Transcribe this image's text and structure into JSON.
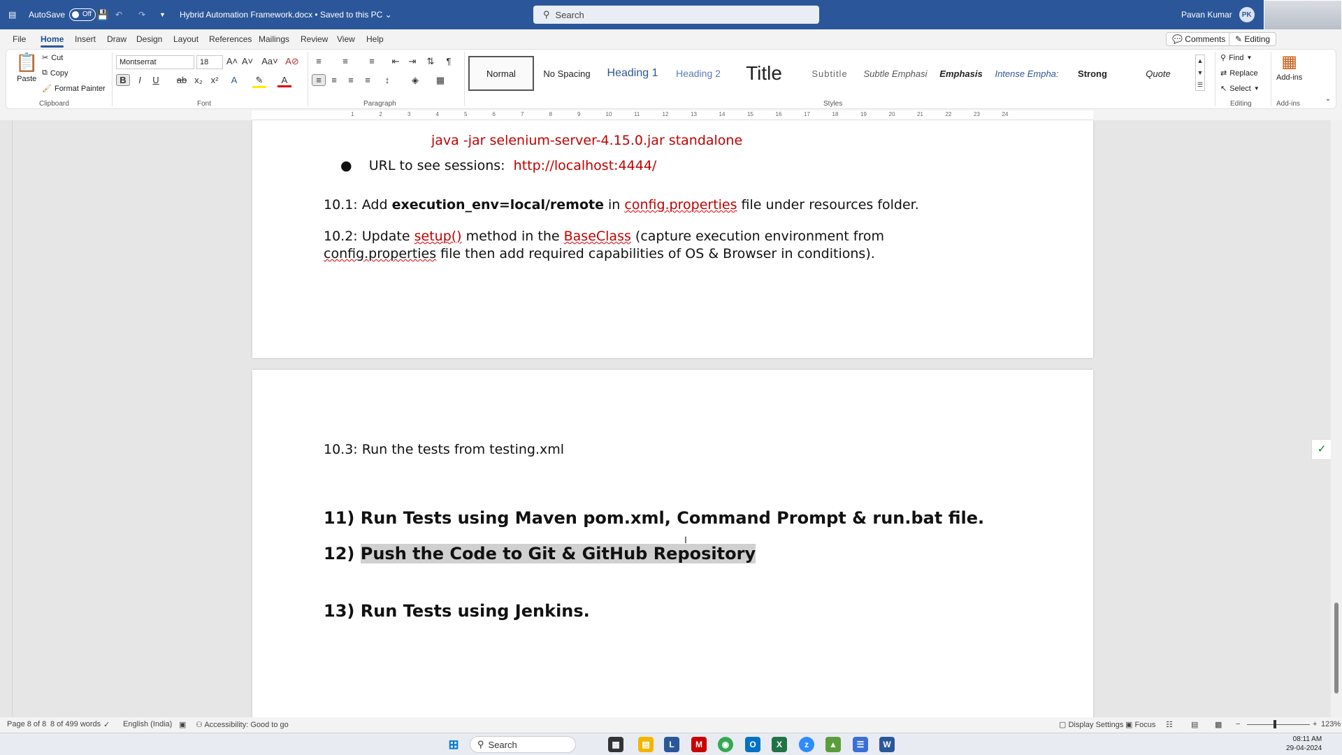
{
  "titlebar": {
    "autosave_label": "AutoSave",
    "autosave_state": "Off",
    "doc_title": "Hybrid Automation Framework.docx • Saved to this PC",
    "search_placeholder": "Search",
    "user_name": "Pavan Kumar",
    "user_initials": "PK"
  },
  "tabs": [
    "File",
    "Home",
    "Insert",
    "Draw",
    "Design",
    "Layout",
    "References",
    "Mailings",
    "Review",
    "View",
    "Help"
  ],
  "active_tab": "Home",
  "tab_buttons": {
    "comments": "Comments",
    "editing": "Editing"
  },
  "ribbon": {
    "clipboard": {
      "paste": "Paste",
      "cut": "Cut",
      "copy": "Copy",
      "format_painter": "Format Painter",
      "label": "Clipboard"
    },
    "font": {
      "family": "Montserrat",
      "size": "18",
      "label": "Font"
    },
    "paragraph": {
      "label": "Paragraph"
    },
    "styles": {
      "items": [
        "Normal",
        "No Spacing",
        "Heading 1",
        "Heading 2",
        "Title",
        "Subtitle",
        "Subtle Emphasi",
        "Emphasis",
        "Intense Empha:",
        "Strong",
        "Quote"
      ],
      "selected": "Normal",
      "label": "Styles"
    },
    "editing": {
      "find": "Find",
      "replace": "Replace",
      "select": "Select",
      "label": "Editing"
    },
    "addins": {
      "button": "Add-ins",
      "label": "Add-ins"
    }
  },
  "ruler_numbers": [
    "1",
    "2",
    "3",
    "4",
    "5",
    "6",
    "7",
    "8",
    "9",
    "10",
    "11",
    "12",
    "13",
    "14",
    "15",
    "16",
    "17",
    "18",
    "19",
    "20",
    "21",
    "22",
    "23",
    "24"
  ],
  "document": {
    "line_command": "java -jar selenium-server-4.15.0.jar standalone",
    "bullet_prefix": "URL to see sessions:",
    "bullet_url": "http://localhost:4444/",
    "p101": {
      "a": "10.1: Add ",
      "b": "execution_env=local/remote",
      "c": " in ",
      "d": "config.properties",
      "e": " file under resources folder."
    },
    "p102": {
      "a": "10.2: Update ",
      "b": "setup()",
      "c": " method in the ",
      "d": "BaseClass",
      "e": " (capture execution environment from",
      "f": "config.properties",
      "g": " file then add required capabilities of OS & Browser in conditions)."
    },
    "p103": "10.3: Run the tests from testing.xml",
    "h11": "11) Run Tests using Maven pom.xml, Command Prompt & run.bat file.",
    "h12_prefix": "12) ",
    "h12_text": "Push the Code to Git & GitHub Repository",
    "h13": "13) Run Tests using Jenkins."
  },
  "statusbar": {
    "page": "Page 8 of 8",
    "words": "8 of 499 words",
    "language": "English (India)",
    "accessibility": "Accessibility: Good to go",
    "display_settings": "Display Settings",
    "focus": "Focus",
    "zoom": "123%"
  },
  "taskbar": {
    "search": "Search",
    "time": "08:11 AM",
    "date": "29-04-2024"
  },
  "colors": {
    "word_blue": "#2b579a",
    "doc_red": "#c00000"
  }
}
